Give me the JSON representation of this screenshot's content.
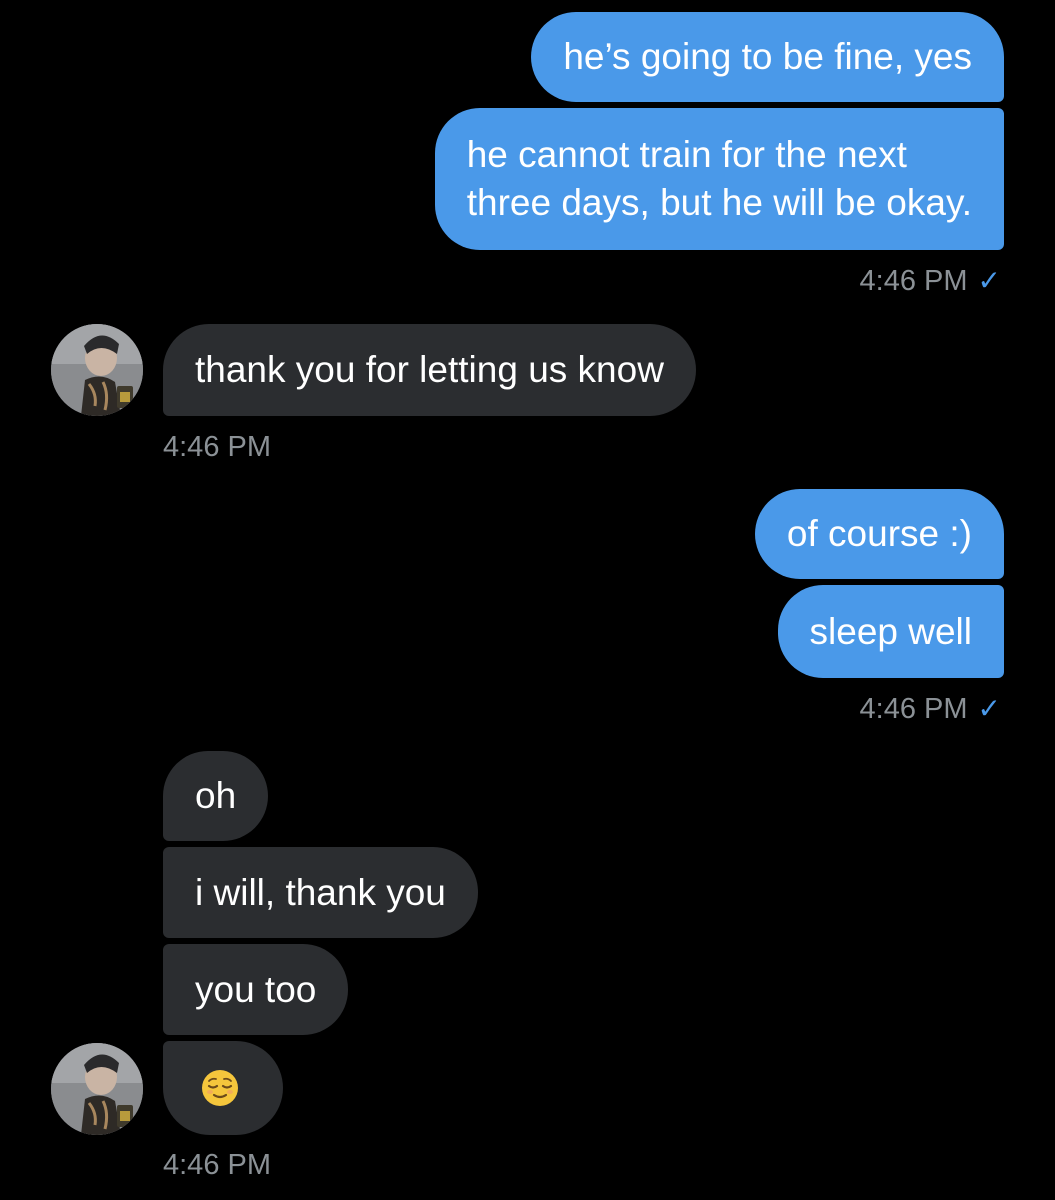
{
  "messages": {
    "sent_1": "he’s going to be fine, yes",
    "sent_2_line1": "he cannot train for the next",
    "sent_2_line2": "three days, but he will be okay.",
    "time_1": "4:46 PM",
    "recv_1": "thank you for letting us know",
    "time_2": "4:46 PM",
    "sent_3": "of course :)",
    "sent_4": "sleep well",
    "time_3": "4:46 PM",
    "recv_2": "oh",
    "recv_3": "i will, thank you",
    "recv_4": "you too",
    "time_4": "4:46 PM"
  },
  "read_receipt": "✓",
  "icons": {
    "avatar": "contact-avatar",
    "emoji": "relieved-face-emoji"
  },
  "colors": {
    "background": "#000000",
    "sent_bubble": "#4a99e9",
    "received_bubble": "#2b2d30",
    "timestamp": "#8b9196",
    "read_check": "#4a99e9"
  }
}
